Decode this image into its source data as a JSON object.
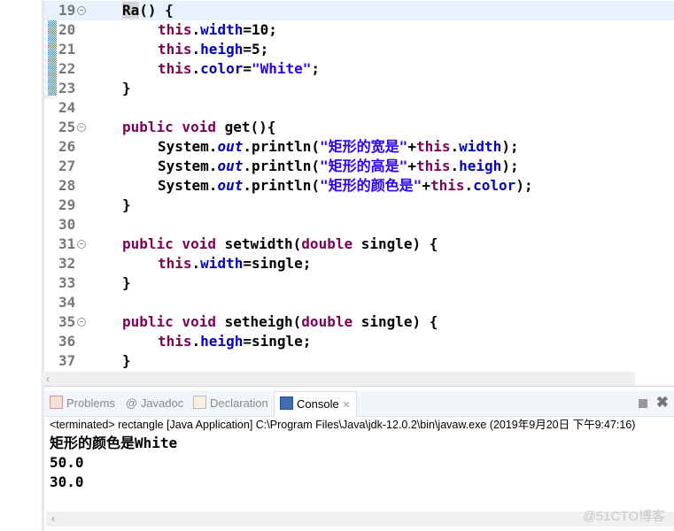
{
  "editor": {
    "lines": [
      {
        "n": "19",
        "fold": true,
        "cur": true,
        "ind": 1,
        "seg": [
          [
            "Ra",
            "hl"
          ],
          [
            "() {",
            ""
          ]
        ]
      },
      {
        "n": "20",
        "ind": 2,
        "seg": [
          [
            "this",
            "kw"
          ],
          [
            ".",
            ""
          ],
          [
            "width",
            "fld"
          ],
          [
            "=10;",
            ""
          ]
        ]
      },
      {
        "n": "21",
        "ind": 2,
        "seg": [
          [
            "this",
            "kw"
          ],
          [
            ".",
            ""
          ],
          [
            "heigh",
            "fld"
          ],
          [
            "=5;",
            ""
          ]
        ]
      },
      {
        "n": "22",
        "ind": 2,
        "seg": [
          [
            "this",
            "kw"
          ],
          [
            ".",
            ""
          ],
          [
            "color",
            "fld"
          ],
          [
            "=",
            ""
          ],
          [
            "\"White\"",
            "str"
          ],
          [
            ";",
            ""
          ]
        ]
      },
      {
        "n": "23",
        "ind": 1,
        "seg": [
          [
            "}",
            ""
          ]
        ]
      },
      {
        "n": "24",
        "ind": 0,
        "seg": []
      },
      {
        "n": "25",
        "fold": true,
        "ind": 1,
        "seg": [
          [
            "public void",
            "kw"
          ],
          [
            " get(){",
            ""
          ]
        ]
      },
      {
        "n": "26",
        "ind": 2,
        "seg": [
          [
            "System.",
            ""
          ],
          [
            "out",
            "it"
          ],
          [
            ".println(",
            ""
          ],
          [
            "\"矩形的宽是\"",
            "str"
          ],
          [
            "+",
            ""
          ],
          [
            "this",
            "kw"
          ],
          [
            ".",
            ""
          ],
          [
            "width",
            "fld"
          ],
          [
            ");",
            ""
          ]
        ]
      },
      {
        "n": "27",
        "ind": 2,
        "seg": [
          [
            "System.",
            ""
          ],
          [
            "out",
            "it"
          ],
          [
            ".println(",
            ""
          ],
          [
            "\"矩形的高是\"",
            "str"
          ],
          [
            "+",
            ""
          ],
          [
            "this",
            "kw"
          ],
          [
            ".",
            ""
          ],
          [
            "heigh",
            "fld"
          ],
          [
            ");",
            ""
          ]
        ]
      },
      {
        "n": "28",
        "ind": 2,
        "seg": [
          [
            "System.",
            ""
          ],
          [
            "out",
            "it"
          ],
          [
            ".println(",
            ""
          ],
          [
            "\"矩形的颜色是\"",
            "str"
          ],
          [
            "+",
            ""
          ],
          [
            "this",
            "kw"
          ],
          [
            ".",
            ""
          ],
          [
            "color",
            "fld"
          ],
          [
            ");",
            ""
          ]
        ]
      },
      {
        "n": "29",
        "ind": 1,
        "seg": [
          [
            "}",
            ""
          ]
        ]
      },
      {
        "n": "30",
        "ind": 0,
        "seg": []
      },
      {
        "n": "31",
        "fold": true,
        "ind": 1,
        "seg": [
          [
            "public void",
            "kw"
          ],
          [
            " setwidth(",
            ""
          ],
          [
            "double",
            "kw"
          ],
          [
            " single) {",
            ""
          ]
        ]
      },
      {
        "n": "32",
        "ind": 2,
        "seg": [
          [
            "this",
            "kw"
          ],
          [
            ".",
            ""
          ],
          [
            "width",
            "fld"
          ],
          [
            "=single;",
            ""
          ]
        ]
      },
      {
        "n": "33",
        "ind": 1,
        "seg": [
          [
            "}",
            ""
          ]
        ]
      },
      {
        "n": "34",
        "ind": 0,
        "seg": []
      },
      {
        "n": "35",
        "fold": true,
        "ind": 1,
        "seg": [
          [
            "public void",
            "kw"
          ],
          [
            " setheigh(",
            ""
          ],
          [
            "double",
            "kw"
          ],
          [
            " single) {",
            ""
          ]
        ]
      },
      {
        "n": "36",
        "ind": 2,
        "seg": [
          [
            "this",
            "kw"
          ],
          [
            ".",
            ""
          ],
          [
            "heigh",
            "fld"
          ],
          [
            "=single;",
            ""
          ]
        ]
      },
      {
        "n": "37",
        "ind": 1,
        "seg": [
          [
            "}",
            ""
          ]
        ]
      }
    ]
  },
  "scroll_left": "‹",
  "tabs": [
    {
      "label": "Problems",
      "icon": "problems-icon"
    },
    {
      "label": "Javadoc",
      "icon": "at-icon"
    },
    {
      "label": "Declaration",
      "icon": "declaration-icon"
    },
    {
      "label": "Console",
      "icon": "console-icon",
      "active": true
    }
  ],
  "tab_close": "✕",
  "console": {
    "info": "<terminated> rectangle [Java Application] C:\\Program Files\\Java\\jdk-12.0.2\\bin\\javaw.exe (2019年9月20日 下午9:47:16)",
    "output": [
      "矩形的颜色是White",
      "50.0",
      "30.0"
    ]
  },
  "watermark": "@51CTO博客"
}
